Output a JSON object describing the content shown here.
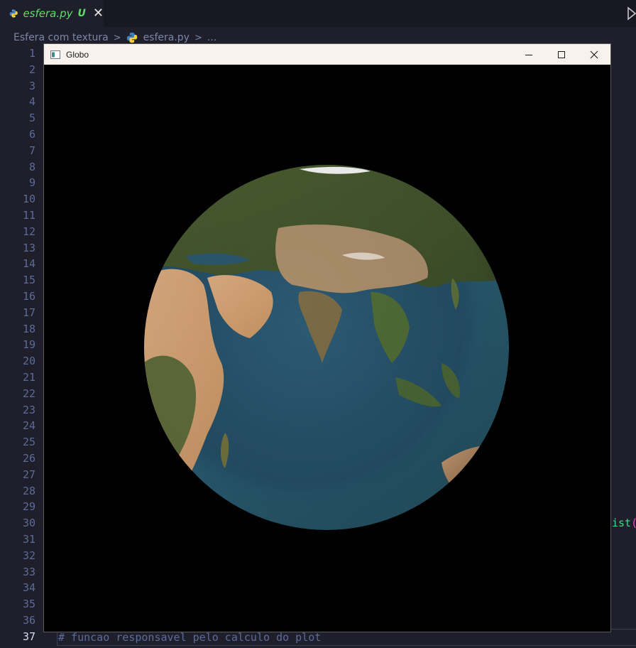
{
  "editor": {
    "tab": {
      "filename": "esfera.py",
      "badge": "U",
      "close_icon": "close-icon",
      "file_icon": "python-icon"
    },
    "breadcrumb": {
      "folder": "Esfera com textura",
      "file": "esfera.py",
      "more": "..."
    },
    "line_numbers": [
      "1",
      "2",
      "3",
      "4",
      "5",
      "6",
      "7",
      "8",
      "9",
      "10",
      "11",
      "12",
      "13",
      "14",
      "15",
      "16",
      "17",
      "18",
      "19",
      "20",
      "21",
      "22",
      "23",
      "24",
      "25",
      "26",
      "27",
      "28",
      "29",
      "30",
      "31",
      "32",
      "33",
      "34",
      "35",
      "36",
      "37"
    ],
    "active_line": "37",
    "line_37_text": "# funcao responsavel pelo calculo do plot",
    "line_30_fragment": {
      "fn": "ist",
      "paren": "("
    },
    "colors": {
      "background": "#1e1f2b",
      "tab_text": "#5ddc6a",
      "line_number": "#5d6b9a",
      "comment": "#5d6b9a"
    }
  },
  "window": {
    "title": "Globo",
    "controls": [
      "minimize-icon",
      "maximize-icon",
      "close-icon"
    ],
    "content": "3D textured globe (Earth) rendered on black background, showing Asia, Africa and the Indian Ocean"
  }
}
